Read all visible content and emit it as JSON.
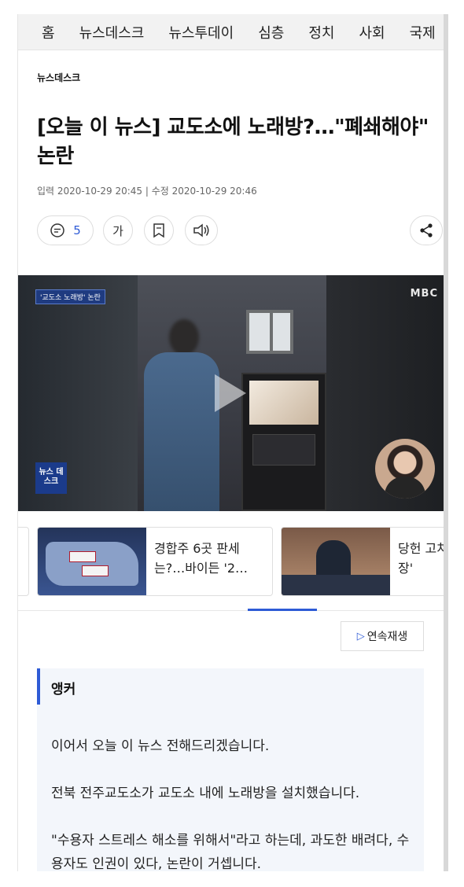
{
  "nav": {
    "items": [
      "홈",
      "뉴스데스크",
      "뉴스투데이",
      "심층",
      "정치",
      "사회",
      "국제"
    ]
  },
  "article": {
    "section": "뉴스데스크",
    "headline": "[오늘 이 뉴스] 교도소에 노래방?…\"폐쇄해야\" 논란",
    "dates": "입력 2020-10-29 20:45 | 수정 2020-10-29 20:46"
  },
  "tools": {
    "comment_count": "5",
    "font_label": "가",
    "icons": [
      "comment-icon",
      "bookmark-icon",
      "speaker-icon",
      "share-icon"
    ]
  },
  "video": {
    "caption_tag": "'교도소 노래방' 논란",
    "broadcaster_logo": "MBC",
    "program_logo": "뉴스 데스크"
  },
  "related": [
    {
      "title": "경합주 6곳 판세는?…바이든 '2…"
    },
    {
      "title": "당헌 고쳐 산시장'"
    }
  ],
  "controls": {
    "autoplay_label": "연속재생"
  },
  "transcript": {
    "speaker": "앵커",
    "paragraphs": [
      "이어서 오늘 이 뉴스 전해드리겠습니다.",
      "전북 전주교도소가 교도소 내에 노래방을 설치했습니다.",
      "\"수용자 스트레스 해소를 위해서\"라고 하는데, 과도한 배려다, 수용자도 인권이 있다, 논란이 거셉니다."
    ]
  },
  "colors": {
    "accent": "#2e5bd6",
    "nav_bg": "#f2f2f2",
    "transcript_bg": "#f3f6fb"
  }
}
